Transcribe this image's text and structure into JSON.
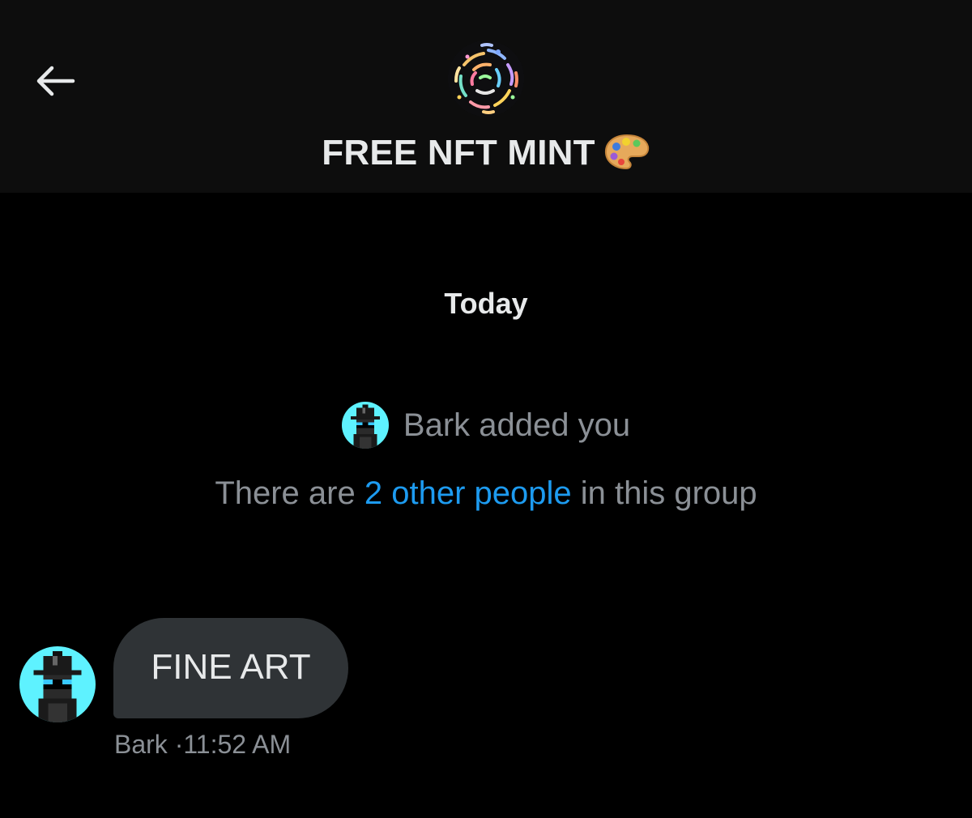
{
  "header": {
    "back_icon": "arrow-left-icon",
    "group_avatar_icon": "abstract-swirl-art-icon",
    "title": "FREE NFT MINT",
    "title_emoji_icon": "artist-palette-icon"
  },
  "conversation": {
    "day_label": "Today",
    "system_event": {
      "avatar_icon": "pixel-hat-character-avatar",
      "text": "Bark added you"
    },
    "group_info": {
      "prefix": "There are",
      "link_text": "2 other people",
      "suffix": "in this group"
    },
    "messages": [
      {
        "sender": "Bark",
        "text": "FINE ART",
        "separator": "·",
        "time": "11:52 AM",
        "avatar_icon": "pixel-hat-character-avatar"
      }
    ]
  },
  "colors": {
    "background": "#000000",
    "header_background": "#0d0d0d",
    "primary_text": "#e7e9ea",
    "secondary_text": "#8b9096",
    "link": "#1d9bf0",
    "bubble": "#2f3336",
    "avatar_bg": "#5ef2ff"
  }
}
